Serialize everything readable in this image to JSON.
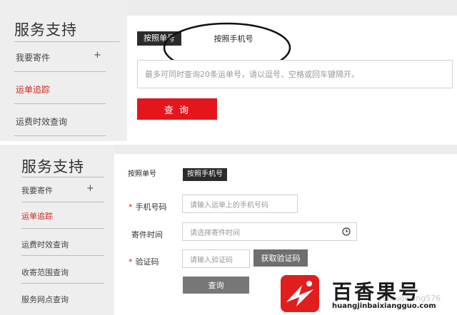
{
  "top_panel": {
    "sidebar": {
      "title": "服务支持",
      "items": [
        {
          "label": "我要寄件",
          "plus": "+"
        },
        {
          "label": "运单追踪"
        },
        {
          "label": "运费时效查询"
        }
      ]
    },
    "tabs": [
      "按照单号",
      "按照手机号"
    ],
    "textarea_placeholder": "最多可同时查询20条运单号，请以逗号、空格或回车键隔开。",
    "query_button": "查 询"
  },
  "bottom_panel": {
    "sidebar": {
      "title": "服务支持",
      "items": [
        {
          "label": "我要寄件",
          "plus": "+"
        },
        {
          "label": "运单追踪"
        },
        {
          "label": "运费时效查询"
        },
        {
          "label": "收寄范围查询"
        },
        {
          "label": "服务网点查询"
        }
      ]
    },
    "tabs": [
      "按照单号",
      "按照手机号"
    ],
    "form": {
      "phone_label": "手机号码",
      "phone_placeholder": "请输入运单上的手机号码",
      "time_label": "寄件时间",
      "time_placeholder": "请选择寄件时间",
      "code_label": "验证码",
      "code_placeholder": "请输入验证码",
      "required_mark": "*",
      "get_code_button": "获取验证码",
      "query_button": "查询"
    },
    "watermark": "zuiduowang576"
  },
  "logo": {
    "name": "百香果号",
    "url": "huangjinbaixiangguo.com",
    "colors": {
      "red": "#e11e1e",
      "dark": "#1a1a1a"
    }
  }
}
